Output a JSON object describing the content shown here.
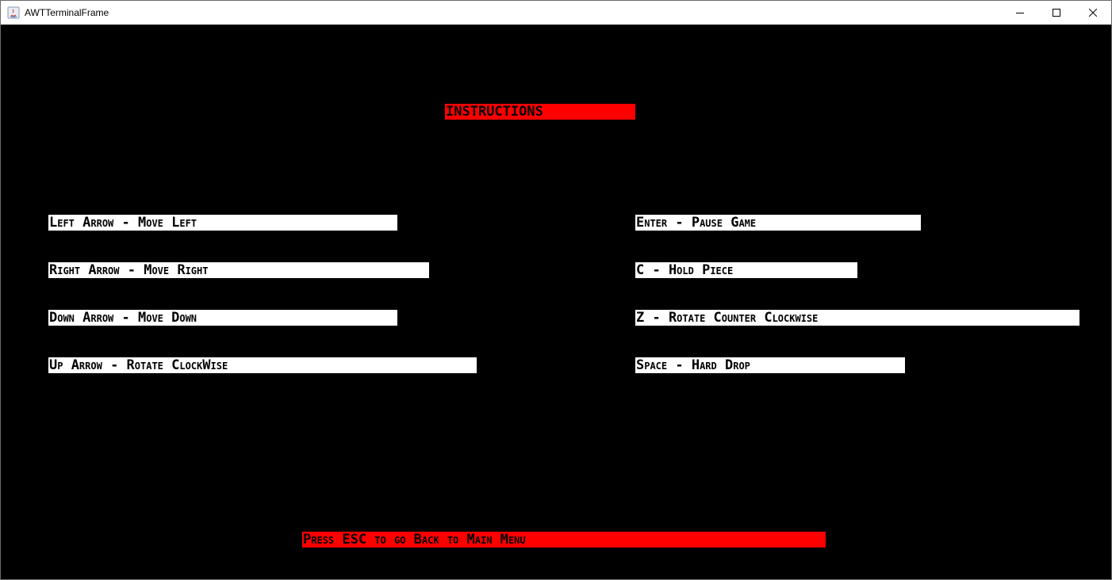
{
  "window": {
    "title": "AWTTerminalFrame"
  },
  "colors": {
    "background": "#000000",
    "instruction_bg": "#ffffff",
    "highlight_bg": "#ff0000",
    "text": "#000000"
  },
  "screen": {
    "heading": "INSTRUCTIONS",
    "controls_left": [
      "Left Arrow - Move Left",
      "Right Arrow - Move Right",
      "Down Arrow - Move Down",
      "Up Arrow - Rotate ClockWise"
    ],
    "controls_right": [
      "Enter - Pause Game",
      "C - Hold Piece",
      "Z - Rotate Counter Clockwise",
      "Space - Hard Drop"
    ],
    "footer": "Press ESC to go Back to Main Menu"
  }
}
